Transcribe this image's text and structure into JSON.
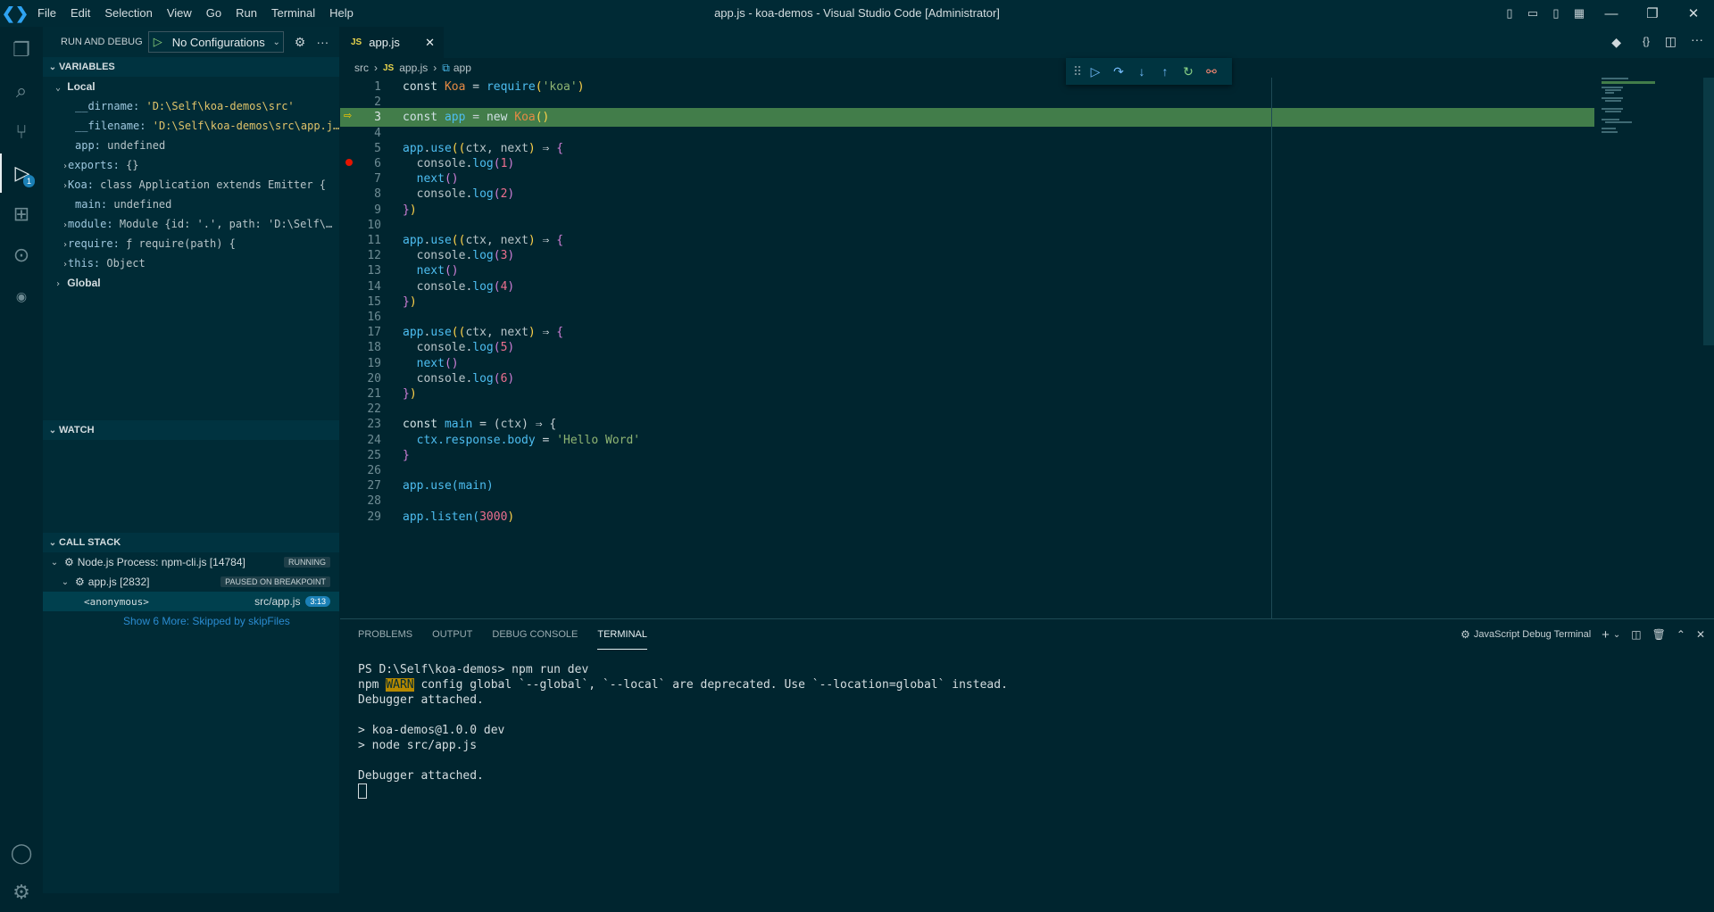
{
  "titlebar": {
    "menu": [
      "File",
      "Edit",
      "Selection",
      "View",
      "Go",
      "Run",
      "Terminal",
      "Help"
    ],
    "title": "app.js - koa-demos - Visual Studio Code [Administrator]"
  },
  "activity": {
    "debug_badge": "1"
  },
  "sidebar": {
    "header": "RUN AND DEBUG",
    "config": "No Configurations",
    "variables_title": "VARIABLES",
    "local_label": "Local",
    "local_vars": [
      {
        "key": "__dirname:",
        "value": "'D:\\Self\\koa-demos\\src'"
      },
      {
        "key": "__filename:",
        "value": "'D:\\Self\\koa-demos\\src\\app.j…"
      },
      {
        "key": "app:",
        "value": "undefined"
      },
      {
        "key": "exports:",
        "value": "{}"
      },
      {
        "key": "Koa:",
        "value": "class Application extends Emitter {"
      },
      {
        "key": "main:",
        "value": "undefined"
      },
      {
        "key": "module:",
        "value": "Module {id: '.', path: 'D:\\Self\\…"
      },
      {
        "key": "require:",
        "value": "ƒ require(path) {"
      },
      {
        "key": "this:",
        "value": "Object"
      }
    ],
    "global_label": "Global",
    "watch_title": "WATCH",
    "callstack_title": "CALL STACK",
    "process": "Node.js Process: npm-cli.js [14784]",
    "process_state": "RUNNING",
    "thread": "app.js [2832]",
    "thread_state": "PAUSED ON BREAKPOINT",
    "frame": "<anonymous>",
    "frame_file": "src/app.js",
    "frame_pos": "3:13",
    "show_more": "Show 6 More: Skipped by skipFiles"
  },
  "editor": {
    "tab": "app.js",
    "tab_icon": "JS",
    "breadcrumb": [
      "src",
      "app.js",
      "app"
    ]
  },
  "panel": {
    "tabs": [
      "PROBLEMS",
      "OUTPUT",
      "DEBUG CONSOLE",
      "TERMINAL"
    ],
    "terminal_name": "JavaScript Debug Terminal",
    "lines": {
      "l1": "PS D:\\Self\\koa-demos> npm run dev",
      "l2a": "npm ",
      "l2b": "WARN",
      "l2c": " config global `--global`, `--local` are deprecated. Use `--location=global` instead.",
      "l3": "Debugger attached.",
      "l4": "",
      "l5": "> koa-demos@1.0.0 dev",
      "l6": "> node src/app.js",
      "l7": "",
      "l8": "Debugger attached."
    }
  },
  "code": {
    "l1": [
      "const ",
      "Koa",
      " = ",
      "require",
      "(",
      "'koa'",
      ")"
    ],
    "l3": [
      "const ",
      "app",
      " = ",
      "new ",
      "Koa",
      "()"
    ],
    "use": "app.use",
    "params": "ctx, next",
    "console_log": "console.log",
    "next": "next()",
    "nums": [
      "1",
      "2",
      "3",
      "4",
      "5",
      "6"
    ],
    "l23": [
      "const ",
      "main",
      " = (",
      "ctx",
      ") ⇒ {"
    ],
    "l24": [
      "ctx.response.body",
      " = ",
      "'Hello Word'"
    ],
    "l27": "app.use(main)",
    "l29": [
      "app.listen(",
      "3000",
      ")"
    ],
    "line_numbers": [
      "1",
      "2",
      "3",
      "4",
      "5",
      "6",
      "7",
      "8",
      "9",
      "10",
      "11",
      "12",
      "13",
      "14",
      "15",
      "16",
      "17",
      "18",
      "19",
      "20",
      "21",
      "22",
      "23",
      "24",
      "25",
      "26",
      "27",
      "28",
      "29"
    ]
  }
}
